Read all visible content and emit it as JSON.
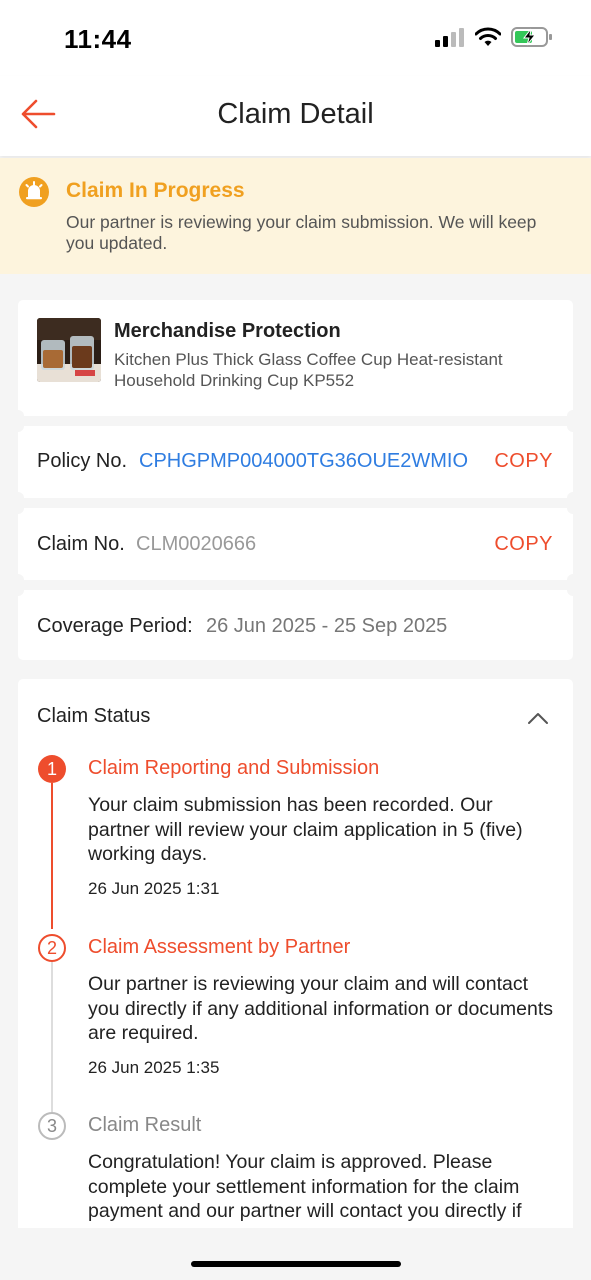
{
  "status_bar": {
    "time": "11:44"
  },
  "header": {
    "title": "Claim Detail"
  },
  "banner": {
    "title": "Claim In Progress",
    "message": "Our partner is reviewing your claim submission. We will keep you updated."
  },
  "product": {
    "type": "Merchandise Protection",
    "name": "Kitchen Plus Thick Glass Coffee Cup Heat-resistant Household Drinking Cup KP552"
  },
  "policy": {
    "label": "Policy No.",
    "value": "CPHGPMP004000TG36OUE2WMIO",
    "copy": "COPY"
  },
  "claim": {
    "label": "Claim No.",
    "value": "CLM0020666",
    "copy": "COPY"
  },
  "coverage": {
    "label": "Coverage Period:",
    "value": "26 Jun 2025 - 25 Sep 2025"
  },
  "claim_status": {
    "title": "Claim Status",
    "steps": [
      {
        "number": "1",
        "title": "Claim Reporting and Submission",
        "body": "Your claim submission has been recorded. Our partner will review your claim application in 5 (five) working days.",
        "date": "26 Jun 2025 1:31"
      },
      {
        "number": "2",
        "title": "Claim Assessment by Partner",
        "body": "Our partner is reviewing your claim and will contact you directly if any additional information or documents are required.",
        "date": "26 Jun 2025 1:35"
      },
      {
        "number": "3",
        "title": "Claim Result",
        "body": "Congratulation! Your claim is approved. Please complete your settlement information for the claim payment and our partner will contact you directly if any document is required."
      }
    ]
  },
  "colors": {
    "accent": "#ee4d2d",
    "link": "#2f7de1",
    "warning": "#f0a020",
    "banner_bg": "#fdf4dd",
    "muted": "#999999"
  },
  "icons": [
    "signal-icon",
    "wifi-icon",
    "battery-charging-icon",
    "back-arrow-icon",
    "bell-icon",
    "chevron-up-icon"
  ]
}
